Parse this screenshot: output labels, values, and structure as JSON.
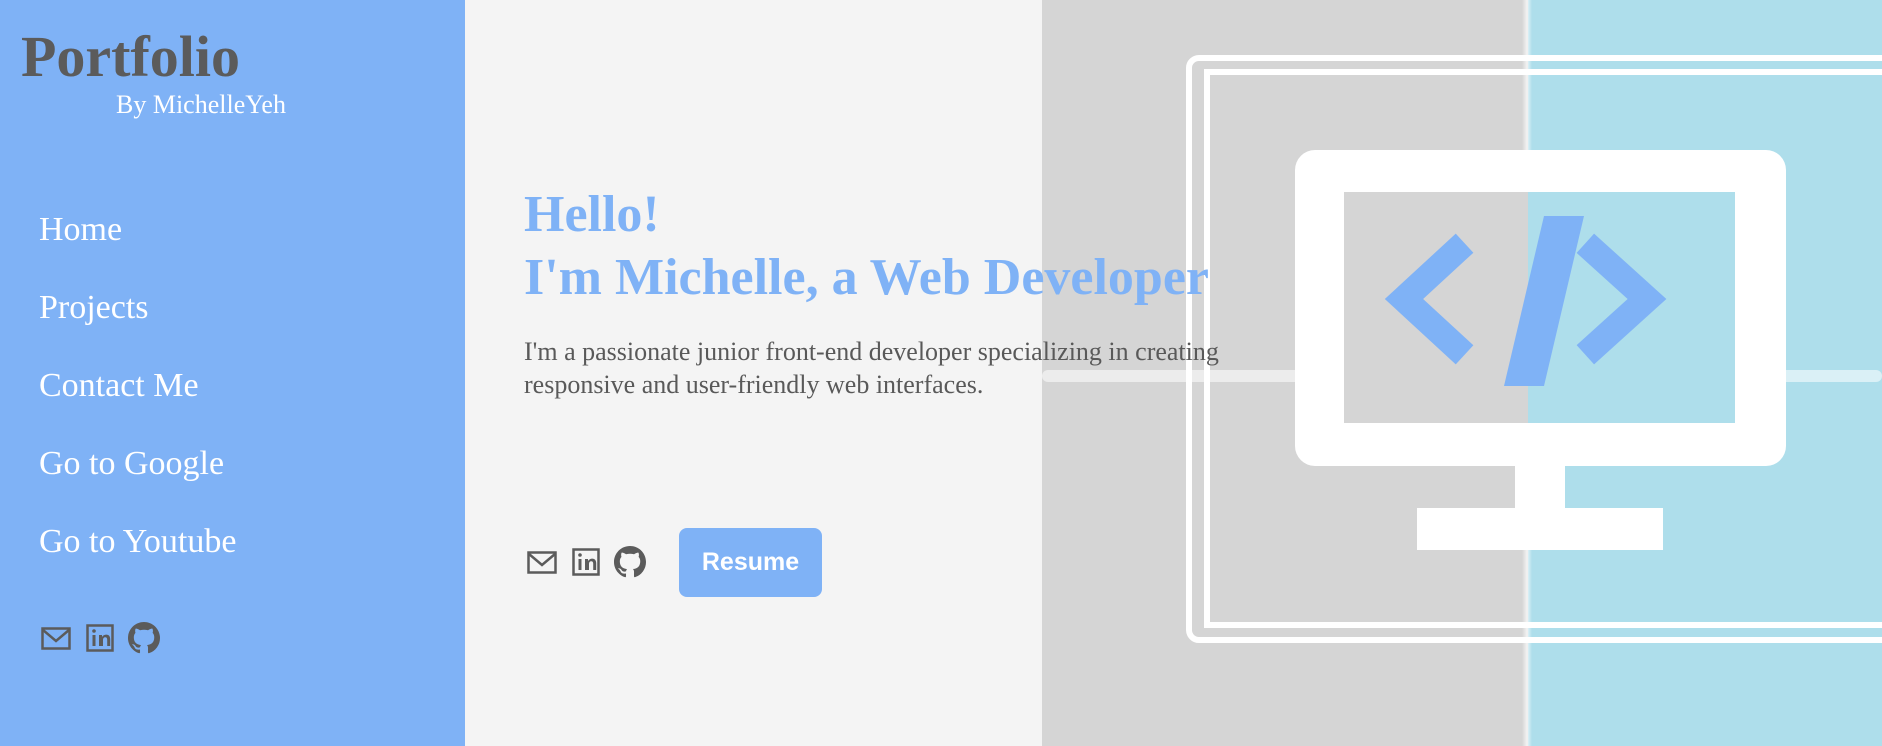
{
  "sidebar": {
    "brand_title": "Portfolio",
    "brand_subtitle": "By MichelleYeh",
    "nav_items": [
      {
        "label": "Home"
      },
      {
        "label": "Projects"
      },
      {
        "label": "Contact Me"
      },
      {
        "label": "Go to Google"
      },
      {
        "label": "Go to Youtube"
      }
    ],
    "social_icons": [
      "mail-icon",
      "linkedin-icon",
      "github-icon"
    ]
  },
  "hero": {
    "greeting": "Hello!",
    "headline": "I'm Michelle, a Web Developer",
    "description": "I'm a passionate junior front-end developer specializing in creating responsive and user-friendly web interfaces.",
    "resume_label": "Resume",
    "social_icons": [
      "mail-icon",
      "linkedin-icon",
      "github-icon"
    ],
    "graphic_icon": "monitor-code-icon"
  },
  "colors": {
    "accent": "#7fb2f6",
    "text_dark": "#5b5b5b",
    "panel_grey": "#d5d5d5",
    "panel_blue": "#aedeeb",
    "background": "#f4f4f4"
  }
}
